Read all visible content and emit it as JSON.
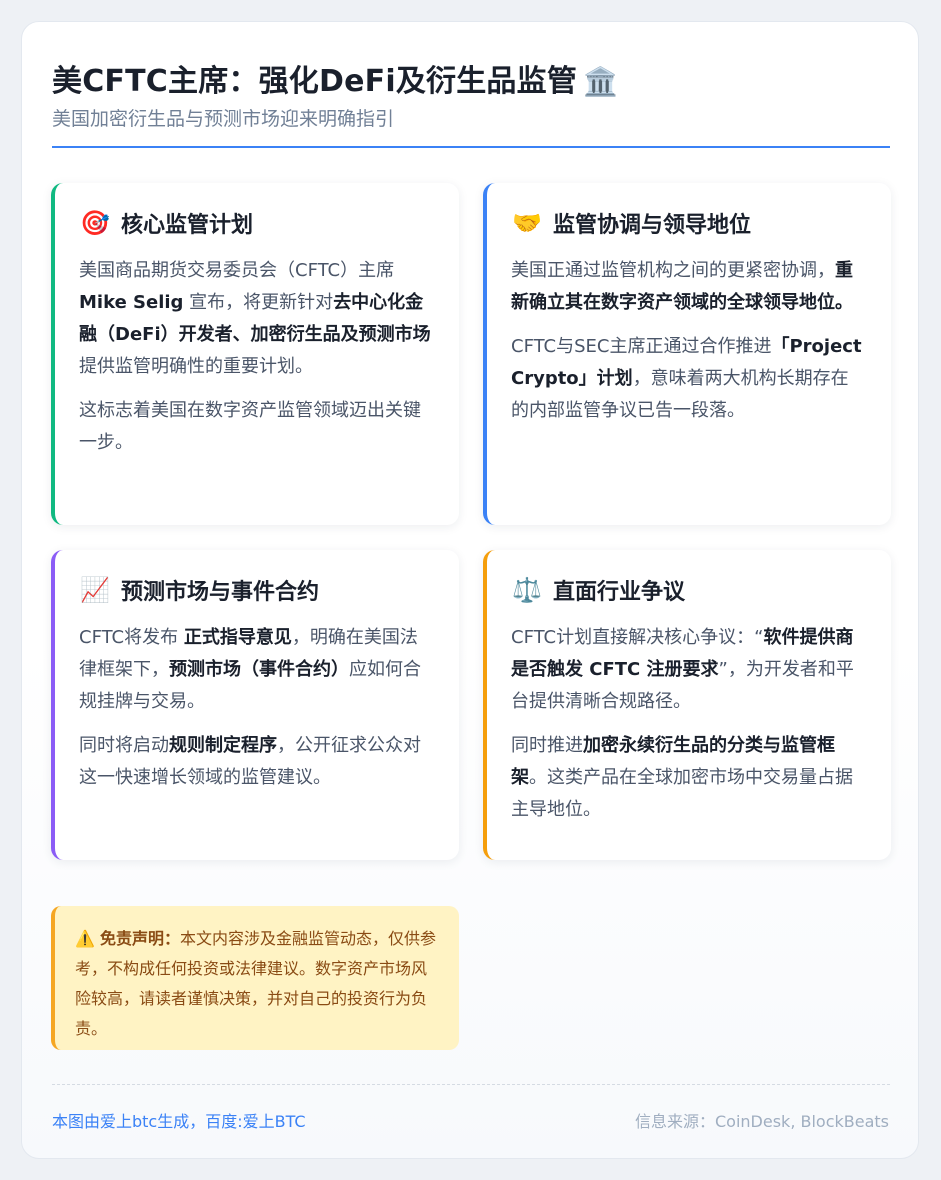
{
  "header": {
    "title": "美CFTC主席：强化DeFi及衍生品监管",
    "title_icon": "🏛️",
    "subtitle": "美国加密衍生品与预测市场迎来明确指引"
  },
  "cards": [
    {
      "icon": "🎯",
      "icon_name": "target-icon",
      "accent": "#10b981",
      "title": "核心监管计划",
      "p1": {
        "a": "美国商品期货交易委员会（CFTC）主席 ",
        "b": "Mike Selig",
        "c": " 宣布，将更新针对",
        "d": "去中心化金融（DeFi）开发者、加密衍生品及预测市场",
        "e": "提供监管明确性的重要计划。"
      },
      "p2": "这标志着美国在数字资产监管领域迈出关键一步。"
    },
    {
      "icon": "🤝",
      "icon_name": "handshake-icon",
      "accent": "#3b82f6",
      "title": "监管协调与领导地位",
      "p1": {
        "a": "美国正通过监管机构之间的更紧密协调，",
        "b": "重新确立其在数字资产领域的全球领导地位。"
      },
      "p2": {
        "a": "CFTC与SEC主席正通过合作推进",
        "b": "「Project Crypto」计划",
        "c": "，意味着两大机构长期存在的内部监管争议已告一段落。"
      }
    },
    {
      "icon": "📈",
      "icon_name": "chart-increasing-icon",
      "accent": "#8b5cf6",
      "title": "预测市场与事件合约",
      "p1": {
        "a": "CFTC将发布 ",
        "b": "正式指导意见",
        "c": "，明确在美国法律框架下，",
        "d": "预测市场（事件合约）",
        "e": "应如何合规挂牌与交易。"
      },
      "p2": {
        "a": "同时将启动",
        "b": "规则制定程序",
        "c": "，公开征求公众对这一快速增长领域的监管建议。"
      }
    },
    {
      "icon": "⚖️",
      "icon_name": "balance-scale-icon",
      "accent": "#f59e0b",
      "title": "直面行业争议",
      "p1": {
        "a": "CFTC计划直接解决核心争议：“",
        "b": "软件提供商是否触发 CFTC 注册要求",
        "c": "”，为开发者和平台提供清晰合规路径。"
      },
      "p2": {
        "a": "同时推进",
        "b": "加密永续衍生品的分类与监管框架",
        "c": "。这类产品在全球加密市场中交易量占据主导地位。"
      }
    }
  ],
  "disclaimer": {
    "icon": "⚠️",
    "label": "免责声明：",
    "text": "本文内容涉及金融监管动态，仅供参考，不构成任何投资或法律建议。数字资产市场风险较高，请读者谨慎决策，并对自己的投资行为负责。"
  },
  "footer": {
    "left": "本图由爱上btc生成，百度:爱上BTC",
    "right": "信息来源：CoinDesk, BlockBeats"
  },
  "colors": {
    "accent_blue": "#3b82f6",
    "green": "#10b981",
    "purple": "#8b5cf6",
    "amber": "#f59e0b",
    "disclaimer_bg": "#fff3c4"
  }
}
